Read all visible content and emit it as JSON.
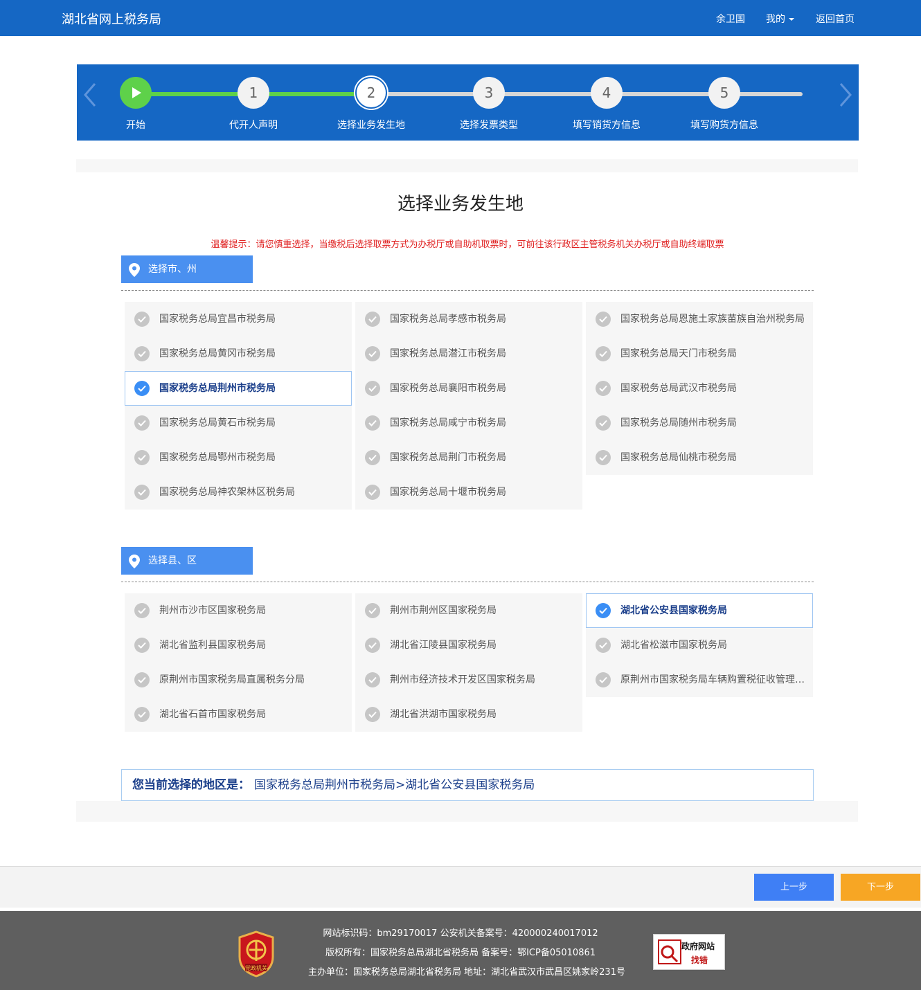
{
  "header": {
    "brand": "湖北省网上税务局",
    "user": "余卫国",
    "mine": "我的",
    "home": "返回首页"
  },
  "stepper": {
    "steps": [
      {
        "num": "",
        "label": "开始"
      },
      {
        "num": "1",
        "label": "代开人声明"
      },
      {
        "num": "2",
        "label": "选择业务发生地"
      },
      {
        "num": "3",
        "label": "选择发票类型"
      },
      {
        "num": "4",
        "label": "填写销货方信息"
      },
      {
        "num": "5",
        "label": "填写购货方信息"
      }
    ]
  },
  "main": {
    "title": "选择业务发生地",
    "tip": "温馨提示：请您慎重选择，当缴税后选择取票方式为办税厅或自助机取票时，可前往该行政区主管税务机关办税厅或自助终端取票"
  },
  "city_section": {
    "label": "选择市、州",
    "col1": [
      "国家税务总局宜昌市税务局",
      "国家税务总局黄冈市税务局",
      "国家税务总局荆州市税务局",
      "国家税务总局黄石市税务局",
      "国家税务总局鄂州市税务局",
      "国家税务总局神农架林区税务局"
    ],
    "col2": [
      "国家税务总局孝感市税务局",
      "国家税务总局潜江市税务局",
      "国家税务总局襄阳市税务局",
      "国家税务总局咸宁市税务局",
      "国家税务总局荆门市税务局",
      "国家税务总局十堰市税务局"
    ],
    "col3": [
      "国家税务总局恩施土家族苗族自治州税务局",
      "国家税务总局天门市税务局",
      "国家税务总局武汉市税务局",
      "国家税务总局随州市税务局",
      "国家税务总局仙桃市税务局"
    ]
  },
  "county_section": {
    "label": "选择县、区",
    "col1": [
      "荆州市沙市区国家税务局",
      "湖北省监利县国家税务局",
      "原荆州市国家税务局直属税务分局",
      "湖北省石首市国家税务局"
    ],
    "col2": [
      "荆州市荆州区国家税务局",
      "湖北省江陵县国家税务局",
      "荆州市经济技术开发区国家税务局",
      "湖北省洪湖市国家税务局"
    ],
    "col3": [
      "湖北省公安县国家税务局",
      "湖北省松滋市国家税务局",
      "原荆州市国家税务局车辆购置税征收管理分局"
    ]
  },
  "summary": {
    "label": "您当前选择的地区是：",
    "value": "国家税务总局荆州市税务局>湖北省公安县国家税务局"
  },
  "actions": {
    "prev": "上一步",
    "next": "下一步"
  },
  "footer": {
    "line1": "网站标识码：bm29170017   公安机关备案号：420000240017012",
    "line2": "版权所有：国家税务总局湖北省税务局       备案号：鄂ICP备05010861",
    "line3": "主办单位：国家税务总局湖北省税务局  地址：湖北省武汉市武昌区姚家岭231号",
    "badge_line1": "政府网站",
    "badge_line2": "找错",
    "emblem_text": "党政机关"
  },
  "colors": {
    "brand_blue": "#1567c4",
    "progress_green": "#5ed14a",
    "tab_blue": "#4a90f0",
    "tip_red": "#e02020",
    "next_orange": "#f7a624",
    "prev_blue": "#3f7ff5"
  }
}
